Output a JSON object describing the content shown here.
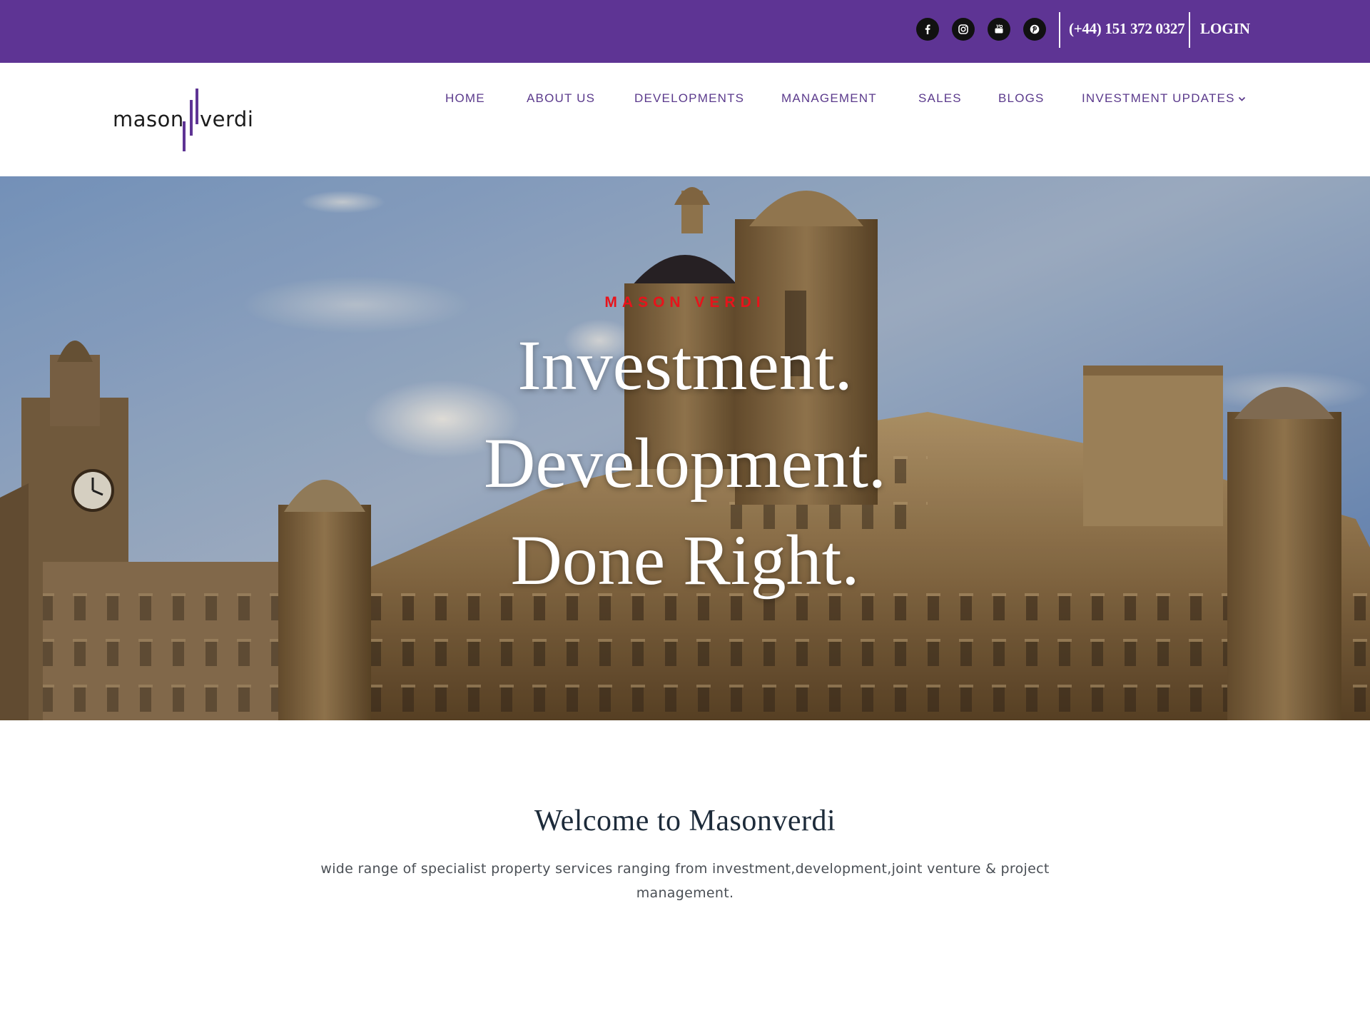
{
  "topbar": {
    "background": "#5e3494",
    "social_icons": [
      "facebook-icon",
      "instagram-icon",
      "youtube-icon",
      "pinterest-icon"
    ],
    "phone": "(+44) 151 372 0327",
    "login_label": "LOGIN"
  },
  "header": {
    "logo_text_left": "mason",
    "logo_text_right": "verdi",
    "logo_accent": "#5e3494"
  },
  "nav": {
    "items": [
      {
        "label": "HOME"
      },
      {
        "label": "ABOUT US"
      },
      {
        "label": "DEVELOPMENTS"
      },
      {
        "label": "MANAGEMENT"
      },
      {
        "label": "SALES"
      },
      {
        "label": "BLOGS"
      },
      {
        "label": "INVESTMENT UPDATES",
        "dropdown": true
      }
    ],
    "color": "#5b3a8c"
  },
  "hero": {
    "kicker": "MASON VERDI",
    "kicker_color": "#e8131b",
    "lines": [
      "Investment.",
      "Development.",
      "Done Right."
    ]
  },
  "welcome": {
    "title": "Welcome to Masonverdi",
    "text": "wide range of specialist property services ranging from investment,development,joint venture & project management."
  }
}
